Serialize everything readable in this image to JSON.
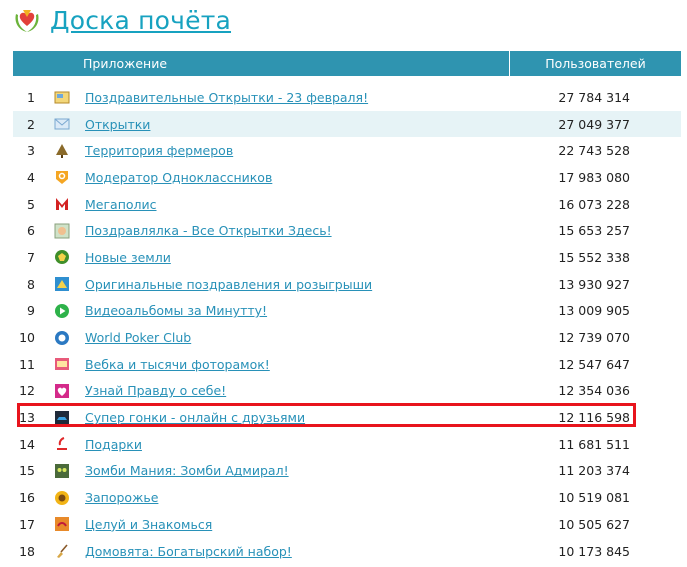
{
  "header": {
    "title": "Доска почёта",
    "logo_icon": "heart-wreath-icon"
  },
  "table": {
    "col_app": "Приложение",
    "col_users": "Пользователей",
    "highlight_color": "#e8141c",
    "header_color": "#2f94b0",
    "rows": [
      {
        "num": "1",
        "name": "Поздравительные Открытки - 23 февраля!",
        "users": "27 784 314",
        "icon": "postcard-icon"
      },
      {
        "num": "2",
        "name": "Открытки",
        "users": "27 049 377",
        "icon": "envelope-icon"
      },
      {
        "num": "3",
        "name": "Территория фермеров",
        "users": "22 743 528",
        "icon": "farm-tree-icon"
      },
      {
        "num": "4",
        "name": "Модератор Одноклассников",
        "users": "17 983 080",
        "icon": "ok-badge-icon"
      },
      {
        "num": "5",
        "name": "Мегаполис",
        "users": "16 073 228",
        "icon": "megapolis-m-icon"
      },
      {
        "num": "6",
        "name": "Поздравлялка - Все Открытки Здесь!",
        "users": "15 653 257",
        "icon": "greeting-face-icon"
      },
      {
        "num": "7",
        "name": "Новые земли",
        "users": "15 552 338",
        "icon": "new-lands-icon"
      },
      {
        "num": "8",
        "name": "Оригинальные поздравления и розыгрыши",
        "users": "13 930 927",
        "icon": "gift-card-icon"
      },
      {
        "num": "9",
        "name": "Видеоальбомы за Минутту!",
        "users": "13 009 905",
        "icon": "play-icon"
      },
      {
        "num": "10",
        "name": "World Poker Club",
        "users": "12 739 070",
        "icon": "poker-chip-icon"
      },
      {
        "num": "11",
        "name": "Вебка и тысячи фоторамок!",
        "users": "12 547 647",
        "icon": "webcam-frame-icon"
      },
      {
        "num": "12",
        "name": "Узнай Правду о себе!",
        "users": "12 354 036",
        "icon": "heart-icon"
      },
      {
        "num": "13",
        "name": "Супер гонки - онлайн с друзьями",
        "users": "12 116 598",
        "icon": "race-car-icon"
      },
      {
        "num": "14",
        "name": "Подарки",
        "users": "11 681 511",
        "icon": "gift-icon"
      },
      {
        "num": "15",
        "name": "Зомби Мания: Зомби Адмирал!",
        "users": "11 203 374",
        "icon": "zombie-icon"
      },
      {
        "num": "16",
        "name": "Запорожье",
        "users": "10 519 081",
        "icon": "sunflower-icon"
      },
      {
        "num": "17",
        "name": "Целуй и Знакомься",
        "users": "10 505 627",
        "icon": "kiss-icon"
      },
      {
        "num": "18",
        "name": "Домовята: Богатырский набор!",
        "users": "10 173 845",
        "icon": "broom-icon"
      }
    ]
  }
}
